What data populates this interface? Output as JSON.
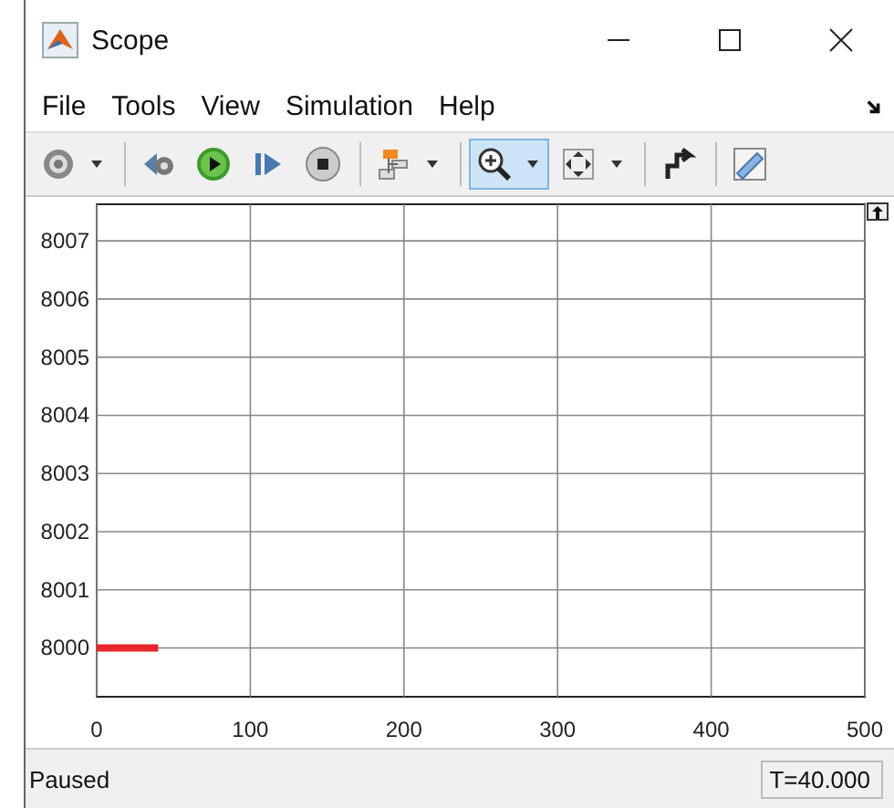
{
  "window": {
    "title": "Scope"
  },
  "menu": [
    {
      "label": "File"
    },
    {
      "label": "Tools"
    },
    {
      "label": "View"
    },
    {
      "label": "Simulation"
    },
    {
      "label": "Help"
    }
  ],
  "toolbar": [
    {
      "kind": "settings",
      "dropdown": true,
      "selected": false
    },
    {
      "kind": "sep"
    },
    {
      "kind": "step-back",
      "dropdown": false,
      "selected": false
    },
    {
      "kind": "run",
      "dropdown": false,
      "selected": false
    },
    {
      "kind": "step-forward",
      "dropdown": false,
      "selected": false
    },
    {
      "kind": "stop",
      "dropdown": false,
      "selected": false
    },
    {
      "kind": "sep"
    },
    {
      "kind": "highlight",
      "dropdown": true,
      "selected": false
    },
    {
      "kind": "sep"
    },
    {
      "kind": "zoom",
      "dropdown": true,
      "selected": true
    },
    {
      "kind": "fit",
      "dropdown": true,
      "selected": false
    },
    {
      "kind": "sep"
    },
    {
      "kind": "signal",
      "dropdown": false,
      "selected": false
    },
    {
      "kind": "sep"
    },
    {
      "kind": "measure",
      "dropdown": false,
      "selected": false
    }
  ],
  "plot": {
    "chart_data": {
      "type": "line",
      "x": [
        0,
        40
      ],
      "series": [
        {
          "color": "#e8262b",
          "values": [
            8000,
            8000
          ]
        }
      ],
      "grid": true,
      "xlim": [
        0,
        500
      ],
      "ylim": [
        7999.16,
        8007.63
      ],
      "xticks": [
        0,
        100,
        200,
        300,
        400,
        500
      ],
      "yticks": [
        8000,
        8001,
        8002,
        8003,
        8004,
        8005,
        8006,
        8007
      ]
    }
  },
  "status_bar": {
    "state": "Paused",
    "time": "T=40.000"
  }
}
